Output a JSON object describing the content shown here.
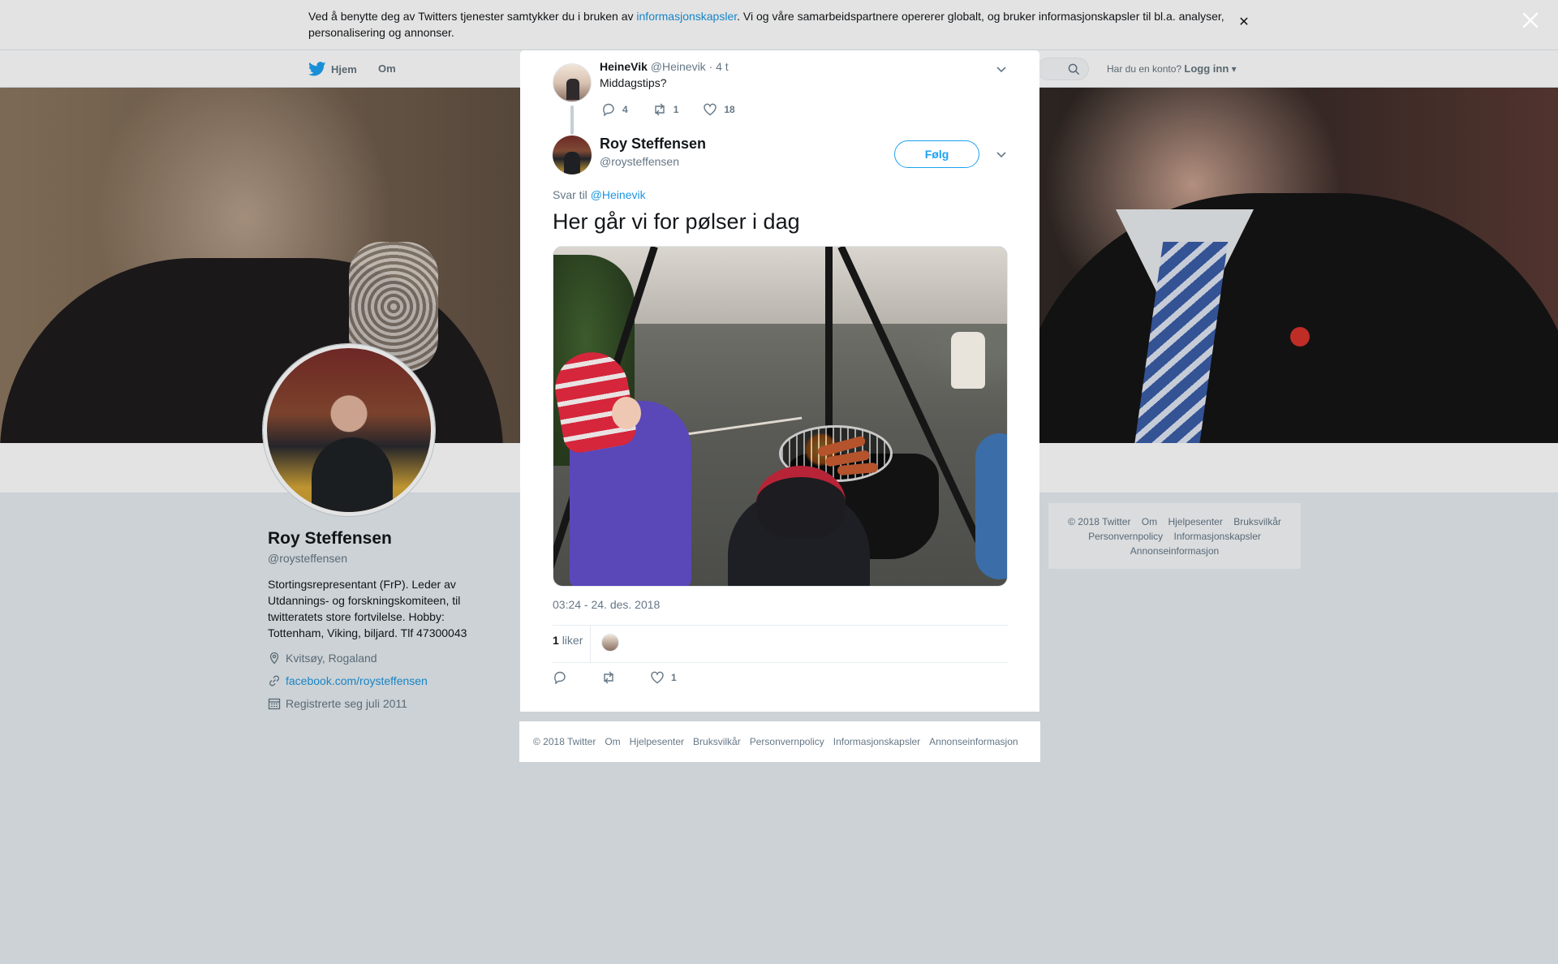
{
  "cookie": {
    "text_before": "Ved å benytte deg av Twitters tjenester samtykker du i bruken av ",
    "link": "informasjonskapsler",
    "text_after": ". Vi og våre samarbeidspartnere opererer globalt, og bruker informasjonskapsler til bl.a. analyser, personalisering og annonser."
  },
  "nav": {
    "home": "Hjem",
    "about": "Om",
    "account_prompt": "Har du en konto?",
    "login": "Logg inn"
  },
  "profile": {
    "name": "Roy Steffensen",
    "handle": "@roysteffensen",
    "bio": "Stortingsrepresentant (FrP). Leder av Utdannings- og forskningskomiteen, til twitteratets store fortvilelse. Hobby: Tottenham, Viking, biljard. Tlf 47300043",
    "location": "Kvitsøy, Rogaland",
    "website": "facebook.com/roysteffensen",
    "joined": "Registrerte seg juli 2011"
  },
  "side_footer": [
    "© 2018 Twitter",
    "Om",
    "Hjelpesenter",
    "Bruksvilkår",
    "Personvernpolicy",
    "Informasjonskapsler",
    "Annonseinformasjon"
  ],
  "parent_tweet": {
    "name": "HeineVik",
    "handle": "@Heinevik",
    "time": "· 4 t",
    "text": "Middagstips?",
    "replies": "4",
    "retweets": "1",
    "likes": "18"
  },
  "tweet": {
    "name": "Roy Steffensen",
    "handle": "@roysteffensen",
    "follow_label": "Følg",
    "reply_prefix": "Svar til",
    "reply_handle": "@Heinevik",
    "text": "Her går vi for pølser i dag",
    "timestamp": "03:24 - 24. des. 2018",
    "like_count": "1",
    "like_label": "liker",
    "action_likes": "1"
  },
  "modal_footer": [
    "© 2018 Twitter",
    "Om",
    "Hjelpesenter",
    "Bruksvilkår",
    "Personvernpolicy",
    "Informasjonskapsler",
    "Annonseinformasjon"
  ],
  "icons": {
    "cookie_close": "close-icon",
    "overlay_close": "close-icon",
    "reply": "reply-icon",
    "retweet": "retweet-icon",
    "like": "heart-icon",
    "caret": "chevron-down-icon",
    "location": "location-icon",
    "link": "link-icon",
    "calendar": "calendar-icon"
  },
  "colors": {
    "accent": "#1da1f2",
    "link": "#1b95e0",
    "muted": "#657786",
    "page_bg": "#e6ecf0"
  }
}
